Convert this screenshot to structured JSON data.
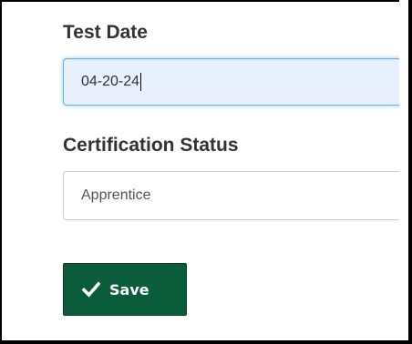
{
  "form": {
    "test_date": {
      "label": "Test Date",
      "value": "04-20-24"
    },
    "certification_status": {
      "label": "Certification Status",
      "value": "Apprentice"
    },
    "save_button": {
      "label": "Save",
      "icon": "check-icon",
      "color": "#0b5c3a"
    }
  }
}
